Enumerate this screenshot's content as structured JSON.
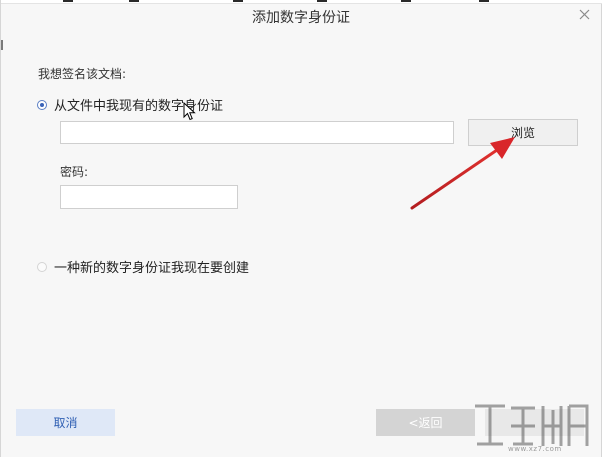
{
  "dialog": {
    "title": "添加数字身份证"
  },
  "form": {
    "section_label": "我想签名该文档:",
    "option_existing": {
      "label": "从文件中我现有的数字身份证",
      "selected": true
    },
    "file_path": {
      "value": "",
      "placeholder": ""
    },
    "browse_label": "浏览",
    "password_label": "密码:",
    "password_value": "",
    "option_new": {
      "label": "一种新的数字身份证我现在要创建",
      "selected": false
    }
  },
  "footer": {
    "cancel_label": "取消",
    "back_label": "<返回"
  },
  "annotation": {
    "arrow_color": "#d9262a"
  },
  "watermark": {
    "url": "www.xz7.com"
  },
  "colors": {
    "accent": "#3a63b8",
    "cancel_bg": "#dfe8f7",
    "cancel_text": "#2f5fb3",
    "disabled_bg": "#d4d4d4"
  }
}
